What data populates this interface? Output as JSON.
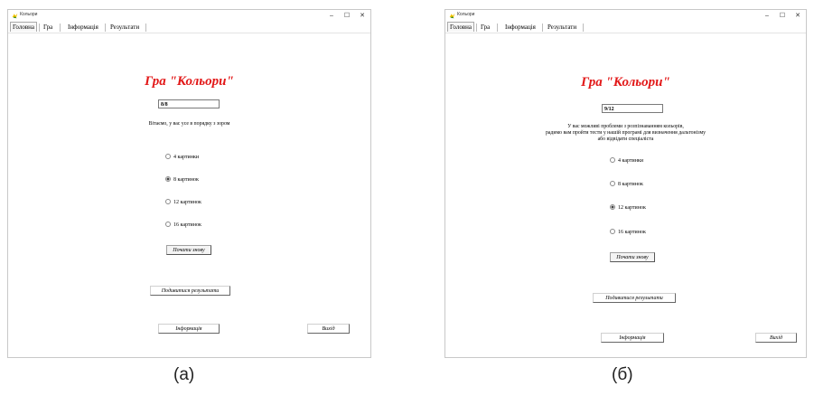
{
  "windows": {
    "a": {
      "title": "Кольори",
      "controls": {
        "minimize": "–",
        "maximize": "☐",
        "close": "✕"
      },
      "menu": [
        "Головна",
        "Гра",
        "Інформація",
        "Результати"
      ],
      "game_title": "Гра \"Кольори\"",
      "score": "8/8",
      "message": [
        "Вітаємо, у вас усе в порядку з зором"
      ],
      "options": [
        "4 картинки",
        "8 картинок",
        "12 картинок",
        "16 картинок"
      ],
      "selected_option": "8 картинок",
      "start_button": "Почати знову",
      "results_button": "Подивитися результати",
      "info_button": "Інформація",
      "exit_button": "Вихід"
    },
    "b": {
      "title": "Кольори",
      "controls": {
        "minimize": "–",
        "maximize": "☐",
        "close": "✕"
      },
      "menu": [
        "Головна",
        "Гра",
        "Інформація",
        "Результати"
      ],
      "game_title": "Гра \"Кольори\"",
      "score": "9/12",
      "message": [
        "У вас можливі проблеми з розпізнаванням кольорів,",
        "радимо вам пройти тести у нашій програмі для визначення дальтонізму",
        "або відвідати спеціаліста"
      ],
      "options": [
        "4 картинки",
        "8 картинок",
        "12 картинок",
        "16 картинок"
      ],
      "selected_option": "12 картинок",
      "start_button": "Почати знову",
      "results_button": "Подивитися результати",
      "info_button": "Інформація",
      "exit_button": "Вихід"
    }
  },
  "captions": {
    "a": "(а)",
    "b": "(б)"
  },
  "colors": {
    "title_red": "#e21818",
    "icon_yellow": "#f2c300",
    "icon_green": "#2a8a2a"
  }
}
